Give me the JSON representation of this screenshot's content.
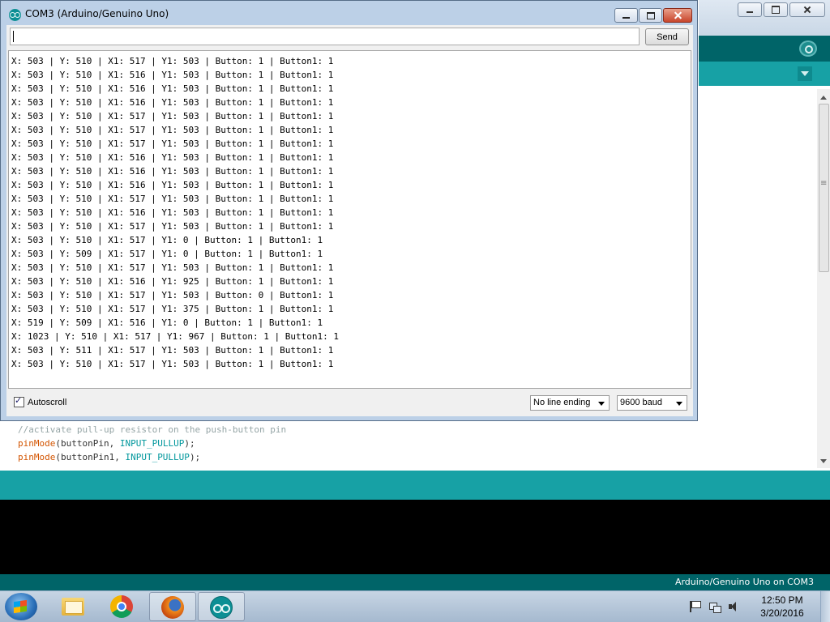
{
  "ide": {
    "code_lines": {
      "comment": "//activate pull-up resistor on the push-button pin",
      "line2_fn": "pinMode",
      "line2_args": "(buttonPin, ",
      "line2_const": "INPUT_PULLUP",
      "line2_end": ");",
      "line3_fn": "pinMode",
      "line3_args": "(buttonPin1, ",
      "line3_const": "INPUT_PULLUP",
      "line3_end": ");"
    },
    "status": "Arduino/Genuino Uno on COM3",
    "icons": [
      "serial-monitor-icon",
      "tab-menu-icon"
    ]
  },
  "serial_monitor": {
    "title": "COM3 (Arduino/Genuino Uno)",
    "input_value": "",
    "send_label": "Send",
    "lines": [
      "X: 503 | Y: 510 | X1: 517 | Y1: 503 | Button: 1 | Button1: 1",
      "X: 503 | Y: 510 | X1: 516 | Y1: 503 | Button: 1 | Button1: 1",
      "X: 503 | Y: 510 | X1: 516 | Y1: 503 | Button: 1 | Button1: 1",
      "X: 503 | Y: 510 | X1: 516 | Y1: 503 | Button: 1 | Button1: 1",
      "X: 503 | Y: 510 | X1: 517 | Y1: 503 | Button: 1 | Button1: 1",
      "X: 503 | Y: 510 | X1: 517 | Y1: 503 | Button: 1 | Button1: 1",
      "X: 503 | Y: 510 | X1: 517 | Y1: 503 | Button: 1 | Button1: 1",
      "X: 503 | Y: 510 | X1: 516 | Y1: 503 | Button: 1 | Button1: 1",
      "X: 503 | Y: 510 | X1: 516 | Y1: 503 | Button: 1 | Button1: 1",
      "X: 503 | Y: 510 | X1: 516 | Y1: 503 | Button: 1 | Button1: 1",
      "X: 503 | Y: 510 | X1: 517 | Y1: 503 | Button: 1 | Button1: 1",
      "X: 503 | Y: 510 | X1: 516 | Y1: 503 | Button: 1 | Button1: 1",
      "X: 503 | Y: 510 | X1: 517 | Y1: 503 | Button: 1 | Button1: 1",
      "X: 503 | Y: 510 | X1: 517 | Y1: 0 | Button: 1 | Button1: 1",
      "X: 503 | Y: 509 | X1: 517 | Y1: 0 | Button: 1 | Button1: 1",
      "X: 503 | Y: 510 | X1: 517 | Y1: 503 | Button: 1 | Button1: 1",
      "X: 503 | Y: 510 | X1: 516 | Y1: 925 | Button: 1 | Button1: 1",
      "X: 503 | Y: 510 | X1: 517 | Y1: 503 | Button: 0 | Button1: 1",
      "X: 503 | Y: 510 | X1: 517 | Y1: 375 | Button: 1 | Button1: 1",
      "X: 519 | Y: 509 | X1: 516 | Y1: 0 | Button: 1 | Button1: 1",
      "X: 1023 | Y: 510 | X1: 517 | Y1: 967 | Button: 1 | Button1: 1",
      "X: 503 | Y: 511 | X1: 517 | Y1: 503 | Button: 1 | Button1: 1",
      "X: 503 | Y: 510 | X1: 517 | Y1: 503 | Button: 1 | Button1: 1"
    ],
    "autoscroll_label": "Autoscroll",
    "autoscroll_checked": true,
    "line_ending": "No line ending",
    "baud": "9600 baud"
  },
  "taskbar": {
    "apps": [
      "windows-explorer",
      "google-chrome",
      "firefox",
      "arduino"
    ],
    "active_app": "arduino",
    "time": "12:50 PM",
    "date": "3/20/2016",
    "tray_icons": [
      "action-center-flag-icon",
      "network-icon",
      "volume-icon"
    ]
  },
  "colors": {
    "arduino_teal": "#17a1a5",
    "arduino_dark_teal": "#006468",
    "code_function": "#d35400",
    "code_constant": "#00979c",
    "code_comment": "#95a5a6"
  }
}
